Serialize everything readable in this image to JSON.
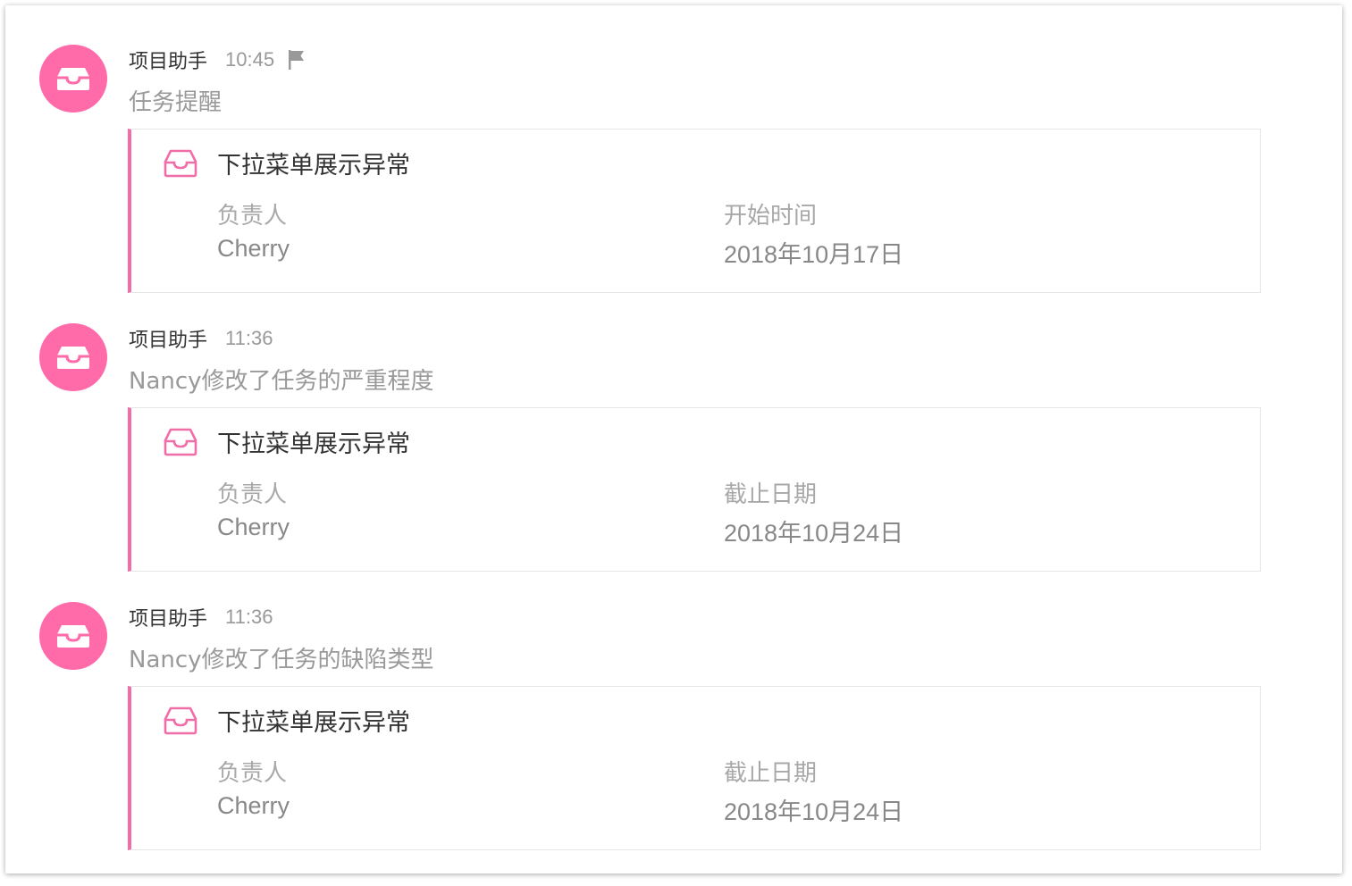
{
  "colors": {
    "accent": "#ff6aa8",
    "card_border": "#ef6ea8",
    "text_primary": "#333333",
    "text_muted": "#999999"
  },
  "messages": [
    {
      "avatar_icon": "inbox-icon",
      "sender": "项目助手",
      "time": "10:45",
      "flag_icon": "flag-icon",
      "summary": "任务提醒",
      "card": {
        "icon": "inbox-icon",
        "title": "下拉菜单展示异常",
        "fields": [
          {
            "label": "负责人",
            "value": "Cherry"
          },
          {
            "label": "开始时间",
            "value": "2018年10月17日"
          }
        ]
      }
    },
    {
      "avatar_icon": "inbox-icon",
      "sender": "项目助手",
      "time": "11:36",
      "summary": "Nancy修改了任务的严重程度",
      "card": {
        "icon": "inbox-icon",
        "title": "下拉菜单展示异常",
        "fields": [
          {
            "label": "负责人",
            "value": "Cherry"
          },
          {
            "label": "截止日期",
            "value": "2018年10月24日"
          }
        ]
      }
    },
    {
      "avatar_icon": "inbox-icon",
      "sender": "项目助手",
      "time": "11:36",
      "summary": "Nancy修改了任务的缺陷类型",
      "card": {
        "icon": "inbox-icon",
        "title": "下拉菜单展示异常",
        "fields": [
          {
            "label": "负责人",
            "value": "Cherry"
          },
          {
            "label": "截止日期",
            "value": "2018年10月24日"
          }
        ]
      }
    }
  ]
}
